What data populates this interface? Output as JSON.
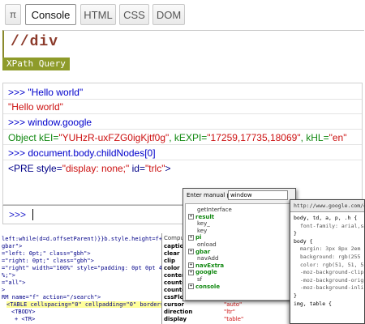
{
  "tabs": {
    "pi": "π",
    "console": "Console",
    "html": "HTML",
    "css": "CSS",
    "dom": "DOM"
  },
  "xpath": {
    "query": "//div",
    "label": "XPath Query"
  },
  "console": {
    "line1": ">>> \"Hello world\"",
    "line2": "\"Hello world\"",
    "line3": ">>> window.google",
    "line4_prefix": "Object kEI=",
    "line4_kei": "\"YUHzR-uxFZG0igKjtf0g\"",
    "line4_mid": ", kEXPI=",
    "line4_kexpi": "\"17259,17735,18069\"",
    "line4_mid2": ", kHL=",
    "line4_khl": "\"en\"",
    "line5": ">>> document.body.childNodes[0]",
    "line6_open": "<PRE style=",
    "line6_style": "\"display: none;\"",
    "line6_id": " id=",
    "line6_idval": "\"trlc\"",
    "line6_close": ">",
    "prompt": ">>>"
  },
  "source": {
    "l1": "left:while(d=d.offsetParent)}}b.style.height=f+\"px\";lib.s",
    "l2": "gbar\">",
    "l3": "=\"left: 0pt;\" class=\"gbh\">",
    "l4": "=\"right: 0pt;\" class=\"gbh\">",
    "l5": "=\"right\" width=\"100%\" style=\"padding: 0pt 0pt 4px;",
    "l6": "%;\">",
    "l7": "=\"all\">",
    "l8": ">",
    "l9": "RM name=\"f\" action=\"/search\">",
    "l10": "<TABLE cellspacing=\"0\" cellpadding=\"0\" border=\"0\">",
    "l11": "<TBODY>",
    "l12": "+ <TR>"
  },
  "computed": {
    "title": "Compu",
    "props": [
      "caption",
      "clear",
      "clip",
      "color",
      "content",
      "counter",
      "counter",
      "cssFloa",
      "cursor",
      "direction",
      "display"
    ],
    "values": [
      "",
      "",
      "",
      "",
      "",
      "",
      "",
      "",
      "\"auto\"",
      "\"ltr\"",
      "\"table\""
    ]
  },
  "manual": {
    "label": "Enter manual path:",
    "value": "window",
    "items": [
      {
        "box": "",
        "name": "getInterface",
        "green": false
      },
      {
        "box": "+",
        "name": "result",
        "green": true
      },
      {
        "box": "",
        "name": "key_",
        "green": false
      },
      {
        "box": "",
        "name": "key",
        "green": false
      },
      {
        "box": "+",
        "name": "pi",
        "green": true
      },
      {
        "box": "",
        "name": "onload",
        "green": false
      },
      {
        "box": "+",
        "name": "gbar",
        "green": true
      },
      {
        "box": "",
        "name": "navAdd",
        "green": false
      },
      {
        "box": "+",
        "name": "navExtra",
        "green": true
      },
      {
        "box": "+",
        "name": "google",
        "green": true
      },
      {
        "box": "",
        "name": "sf",
        "green": false
      },
      {
        "box": "+",
        "name": "console",
        "green": true
      }
    ]
  },
  "csswin": {
    "url": "http://www.google.com/ext",
    "lines": [
      "body, td, a, p, .h {",
      "font-family: arial,sans",
      "}",
      "body {",
      "margin: 3px 8px 2em",
      "background: rgb(255",
      "color: rgb(51, 51, 51",
      "-moz-background-clip",
      "-moz-background-orig",
      "-moz-background-inli",
      "}",
      "img, table {"
    ]
  }
}
